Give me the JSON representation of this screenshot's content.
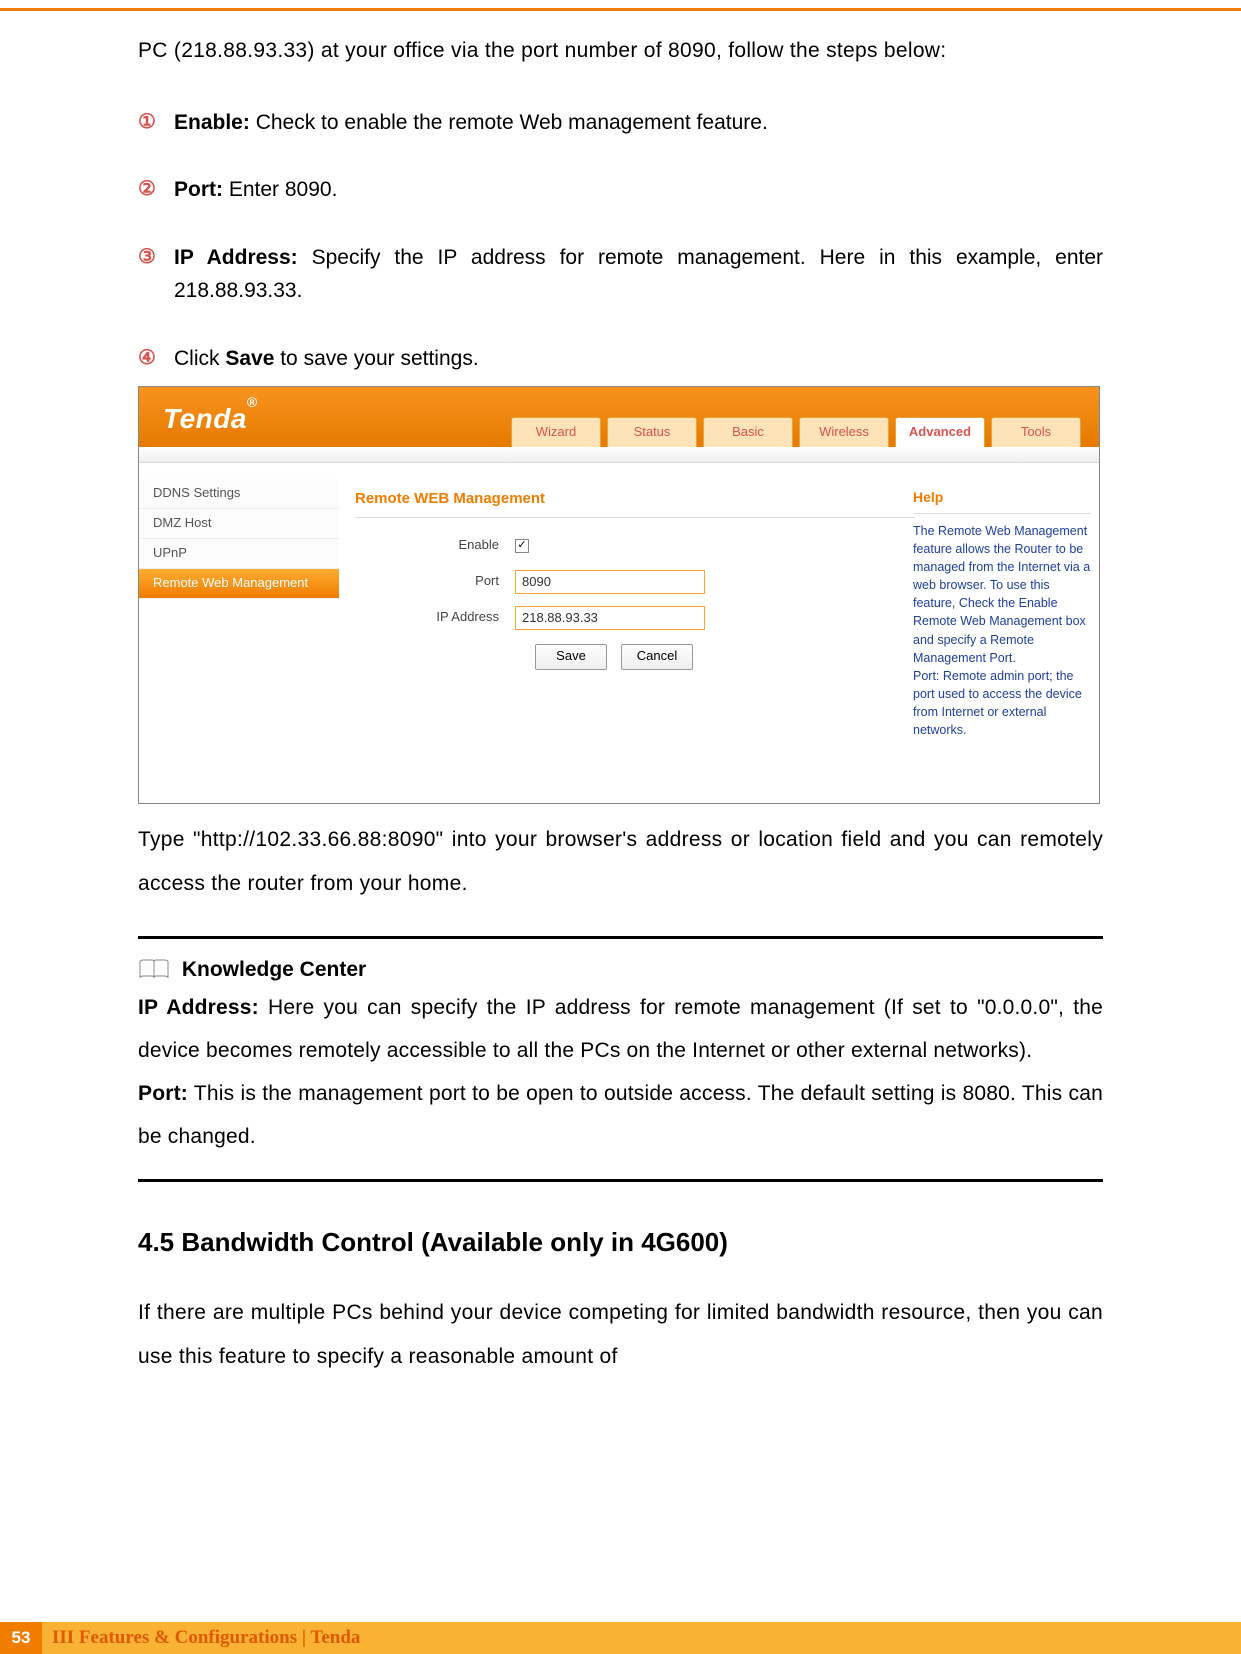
{
  "intro": "PC (218.88.93.33) at your office via the port number of 8090, follow the steps below:",
  "steps": [
    {
      "num": "①",
      "label": "Enable:",
      "text": " Check to enable the remote Web management feature."
    },
    {
      "num": "②",
      "label": "Port:",
      "text": " Enter 8090."
    },
    {
      "num": "③",
      "label": "IP Address:",
      "text": " Specify the IP address for remote management. Here in this example, enter 218.88.93.33."
    },
    {
      "num": "④",
      "label": "",
      "text_pre": "Click ",
      "bold": "Save",
      "text_post": " to save your settings."
    }
  ],
  "screenshot": {
    "logo": "Tenda",
    "tabs": [
      "Wizard",
      "Status",
      "Basic",
      "Wireless",
      "Advanced",
      "Tools"
    ],
    "active_tab": "Advanced",
    "sidebar": [
      "DDNS Settings",
      "DMZ Host",
      "UPnP",
      "Remote Web Management"
    ],
    "active_side": "Remote Web Management",
    "title": "Remote WEB Management",
    "rows": {
      "enable": "Enable",
      "port_lbl": "Port",
      "port_val": "8090",
      "ip_lbl": "IP Address",
      "ip_val": "218.88.93.33"
    },
    "buttons": {
      "save": "Save",
      "cancel": "Cancel"
    },
    "help": {
      "title": "Help",
      "body": "The Remote Web Management feature allows the Router to be managed from the Internet via a web browser. To use this feature, Check the Enable Remote Web Management box and specify a Remote Management Port.\nPort: Remote admin port; the port used to access the device from Internet or external networks."
    }
  },
  "after_ss": "Type \"http://102.33.66.88:8090\" into your browser's address or location field and you can remotely access the router from your home.",
  "kc": {
    "heading": "Knowledge Center",
    "ip_label": "IP Address:",
    "ip_text": " Here you can specify the IP address for remote management (If set to \"0.0.0.0\", the device becomes remotely accessible to all the PCs on the Internet or other external networks).",
    "port_label": "Port:",
    "port_text": " This is the management port to be open to outside access. The default setting is 8080. This can be changed."
  },
  "section": "4.5 Bandwidth Control (Available only in 4G600)",
  "section_body": "If there are multiple PCs behind your device competing for limited bandwidth resource, then you can use this feature to specify a reasonable amount of",
  "footer": {
    "page": "53",
    "text": "III Features & Configurations | Tenda"
  }
}
